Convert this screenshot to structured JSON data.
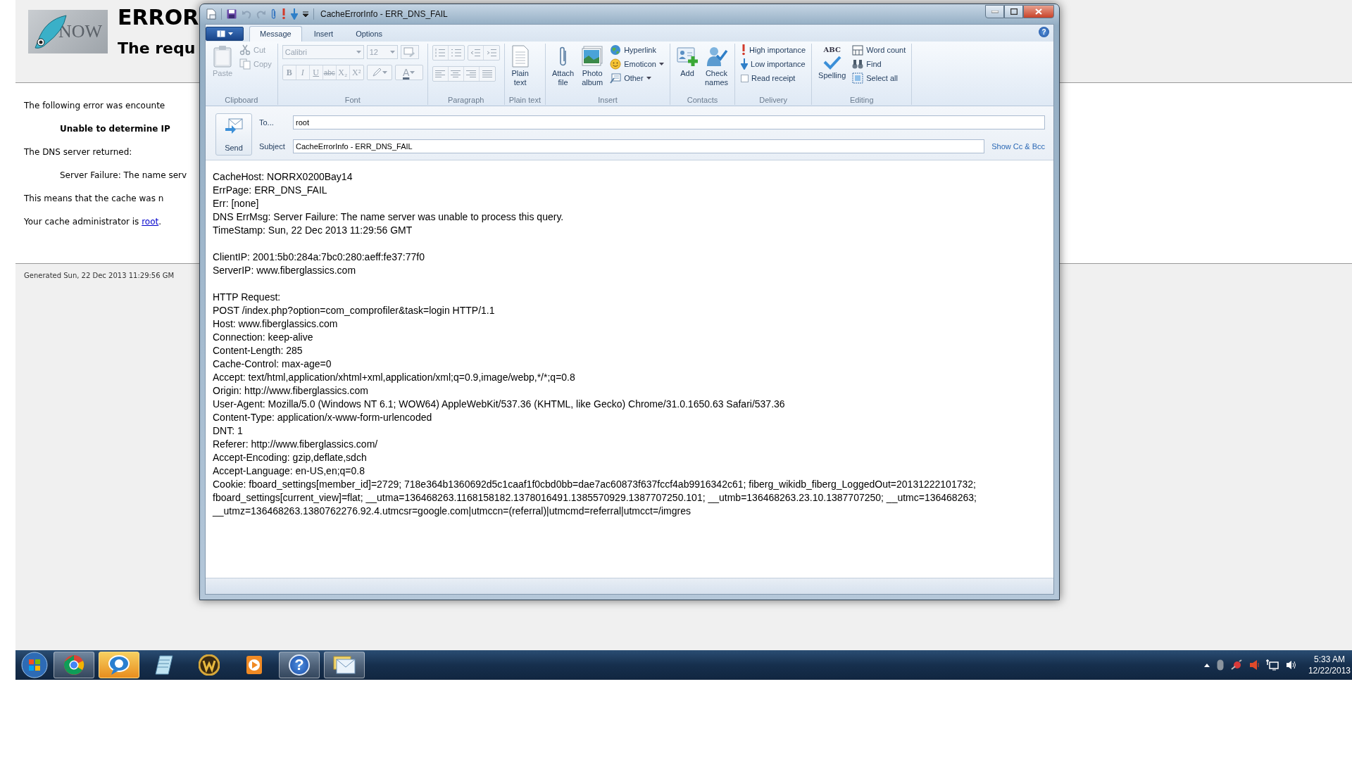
{
  "browser_page": {
    "logo_text": "NOW",
    "heading": "ERROR",
    "subheading": "The requ",
    "paragraphs": [
      {
        "kind": "plain",
        "text": "The following error was encounte"
      },
      {
        "kind": "bold_indent",
        "text": "Unable to determine IP"
      },
      {
        "kind": "plain",
        "text": "The DNS server returned:"
      },
      {
        "kind": "indent",
        "text": "Server Failure: The name serv"
      },
      {
        "kind": "plain",
        "text": "This means that the cache was n"
      },
      {
        "kind": "link",
        "text": "Your cache administrator is ",
        "link": "root",
        "after": "."
      }
    ],
    "footer": "Generated Sun, 22 Dec 2013 11:29:56 GM"
  },
  "window": {
    "title": "CacheErrorInfo - ERR_DNS_FAIL",
    "help_glyph": "?",
    "tabs": [
      {
        "label": "Message",
        "selected": true
      },
      {
        "label": "Insert",
        "selected": false
      },
      {
        "label": "Options",
        "selected": false
      }
    ],
    "ribbon": {
      "groups": [
        {
          "kind": "buttons",
          "label": "Clipboard",
          "disabled": true,
          "items": [
            {
              "kind": "large",
              "lines": [
                "Paste"
              ]
            },
            {
              "kind": "small",
              "label": "Cut"
            },
            {
              "kind": "small",
              "label": "Copy"
            }
          ]
        },
        {
          "kind": "font",
          "label": "Font",
          "disabled": true,
          "font": "Calibri",
          "size": "12",
          "format_buttons": [
            "B",
            "I",
            "U",
            "abc",
            "X₂",
            "X²"
          ],
          "font_color": "A"
        },
        {
          "kind": "paragraph",
          "label": "Paragraph",
          "disabled": true
        },
        {
          "kind": "buttons",
          "label": "Plain text",
          "disabled": false,
          "items": [
            {
              "kind": "large",
              "lines": [
                "Plain",
                "text"
              ]
            }
          ]
        },
        {
          "kind": "buttons",
          "label": "Insert",
          "disabled": false,
          "items": [
            {
              "kind": "large",
              "lines": [
                "Attach",
                "file"
              ]
            },
            {
              "kind": "large",
              "lines": [
                "Photo",
                "album"
              ]
            },
            {
              "kind": "small",
              "label": "Hyperlink",
              "dropdown": false
            },
            {
              "kind": "small",
              "label": "Emoticon",
              "dropdown": true
            },
            {
              "kind": "small",
              "label": "Other",
              "dropdown": true
            }
          ]
        },
        {
          "kind": "buttons",
          "label": "Contacts",
          "disabled": false,
          "items": [
            {
              "kind": "large",
              "lines": [
                "Add"
              ]
            },
            {
              "kind": "large",
              "lines": [
                "Check",
                "names"
              ]
            }
          ]
        },
        {
          "kind": "buttons",
          "label": "Delivery",
          "disabled": false,
          "items": [
            {
              "kind": "small",
              "label": "High importance"
            },
            {
              "kind": "small",
              "label": "Low importance"
            },
            {
              "kind": "check",
              "label": "Read receipt",
              "checked": false
            }
          ]
        },
        {
          "kind": "buttons",
          "label": "Editing",
          "disabled": false,
          "items": [
            {
              "kind": "large",
              "lines": [
                "Spelling"
              ],
              "icon_text": "ABC"
            },
            {
              "kind": "small",
              "label": "Word count"
            },
            {
              "kind": "small",
              "label": "Find"
            },
            {
              "kind": "small",
              "label": "Select all"
            }
          ]
        }
      ]
    },
    "compose": {
      "send": "Send",
      "to_label": "To...",
      "to_value": "root",
      "subject_label": "Subject",
      "subject_value": "CacheErrorInfo - ERR_DNS_FAIL",
      "cc_link": "Show Cc & Bcc"
    },
    "body": {
      "paragraphs": [
        [
          "CacheHost: NORRX0200Bay14",
          "ErrPage: ERR_DNS_FAIL",
          "Err: [none]",
          "DNS ErrMsg: Server Failure: The name server was unable to process this query.",
          "TimeStamp: Sun, 22 Dec 2013 11:29:56 GMT"
        ],
        [
          "ClientIP: 2001:5b0:284a:7bc0:280:aeff:fe37:77f0",
          "ServerIP: www.fiberglassics.com"
        ],
        [
          "HTTP Request:",
          "POST /index.php?option=com_comprofiler&task=login HTTP/1.1",
          "Host: www.fiberglassics.com",
          "Connection: keep-alive",
          "Content-Length: 285",
          "Cache-Control: max-age=0",
          "Accept: text/html,application/xhtml+xml,application/xml;q=0.9,image/webp,*/*;q=0.8",
          "Origin: http://www.fiberglassics.com",
          "User-Agent: Mozilla/5.0 (Windows NT 6.1; WOW64) AppleWebKit/537.36 (KHTML, like Gecko) Chrome/31.0.1650.63 Safari/537.36",
          "Content-Type: application/x-www-form-urlencoded",
          "DNT: 1",
          "Referer: http://www.fiberglassics.com/",
          "Accept-Encoding: gzip,deflate,sdch",
          "Accept-Language: en-US,en;q=0.8",
          "Cookie: fboard_settings[member_id]=2729; 718e364b1360692d5c1caaf1f0cbd0bb=dae7ac60873f637fccf4ab9916342c61; fiberg_wikidb_fiberg_LoggedOut=20131222101732; fboard_settings[current_view]=flat; __utma=136468263.1168158182.1378016491.1385570929.1387707250.101; __utmb=136468263.23.10.1387707250; __utmc=136468263; __utmz=136468263.1380762276.92.4.utmcsr=google.com|utmccn=(referral)|utmcmd=referral|utmcct=/imgres"
        ]
      ]
    }
  },
  "taskbar": {
    "buttons": [
      {
        "kind": "browser",
        "open": true,
        "highlighted": false
      },
      {
        "kind": "chat",
        "open": true,
        "highlighted": true
      },
      {
        "kind": "notepad",
        "open": false,
        "highlighted": false
      },
      {
        "kind": "emblem",
        "open": false,
        "highlighted": false
      },
      {
        "kind": "player",
        "open": false,
        "highlighted": false
      },
      {
        "kind": "help",
        "open": true,
        "highlighted": false,
        "glyph": "?"
      },
      {
        "kind": "mail",
        "open": true,
        "highlighted": false
      }
    ],
    "clock": {
      "time": "5:33 AM",
      "date": "12/22/2013"
    }
  }
}
